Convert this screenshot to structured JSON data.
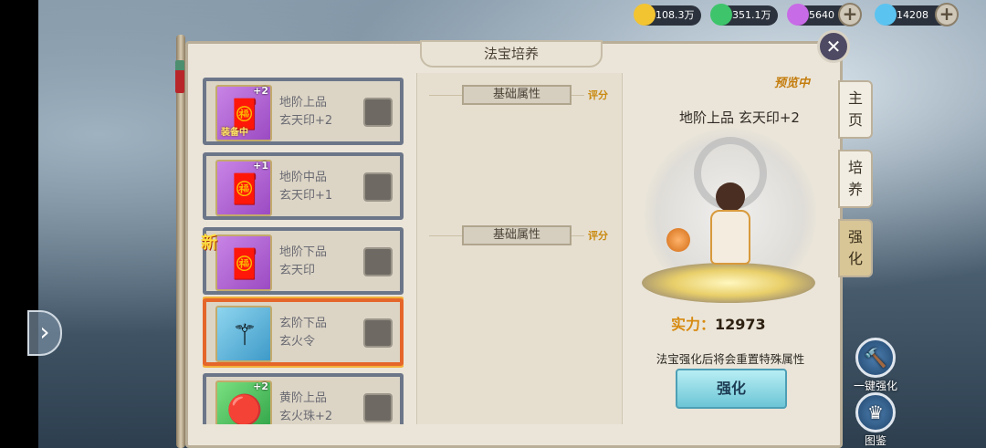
{
  "resources": [
    {
      "name": "coin-icon",
      "value": "108.3万",
      "color": "#f3c431",
      "has_plus": false
    },
    {
      "name": "jade-icon",
      "value": "351.1万",
      "color": "#3ec46b",
      "has_plus": false
    },
    {
      "name": "gem-icon",
      "value": "5640",
      "color": "#c86be6",
      "has_plus": true
    },
    {
      "name": "diamond-icon",
      "value": "14208",
      "color": "#5bc3f0",
      "has_plus": true
    }
  ],
  "panel": {
    "title": "法宝培养",
    "close_icon": "close-icon"
  },
  "items": [
    {
      "name_line1": "地阶上品",
      "name_line2": "玄天印+2",
      "level": "+2",
      "tag": "装备中",
      "rarity": "purple",
      "glyph": "🧧",
      "selected": false
    },
    {
      "name_line1": "地阶中品",
      "name_line2": "玄天印+1",
      "level": "+1",
      "tag": "",
      "rarity": "purple",
      "glyph": "🧧",
      "selected": false
    },
    {
      "name_line1": "地阶下品",
      "name_line2": "玄天印",
      "level": "",
      "tag": "",
      "rarity": "purple",
      "glyph": "🧧",
      "selected": false
    },
    {
      "name_line1": "玄阶下品",
      "name_line2": "玄火令",
      "level": "",
      "tag": "",
      "rarity": "blue",
      "glyph": "⚚",
      "selected": true
    },
    {
      "name_line1": "黄阶上品",
      "name_line2": "玄火珠+2",
      "level": "+2",
      "tag": "",
      "rarity": "green",
      "glyph": "🔴",
      "selected": false
    }
  ],
  "new_badge": "新",
  "attributes": {
    "section1_label": "基础属性",
    "section1_rate": "评分",
    "section2_label": "基础属性",
    "section2_rate": "评分"
  },
  "preview": {
    "label": "预览中",
    "item_name": "地阶上品 玄天印+2",
    "power_label": "实力：",
    "power_value": "12973",
    "note": "法宝强化后将会重置特殊属性",
    "strengthen_button": "强化"
  },
  "tabs": [
    {
      "label": "主页",
      "active": false
    },
    {
      "label": "培养",
      "active": false
    },
    {
      "label": "强化",
      "active": true
    }
  ],
  "actions": [
    {
      "label": "一键强化",
      "icon": "hammer-icon",
      "glyph": "🔨"
    },
    {
      "label": "图鉴",
      "icon": "crown-icon",
      "glyph": "♛"
    }
  ]
}
